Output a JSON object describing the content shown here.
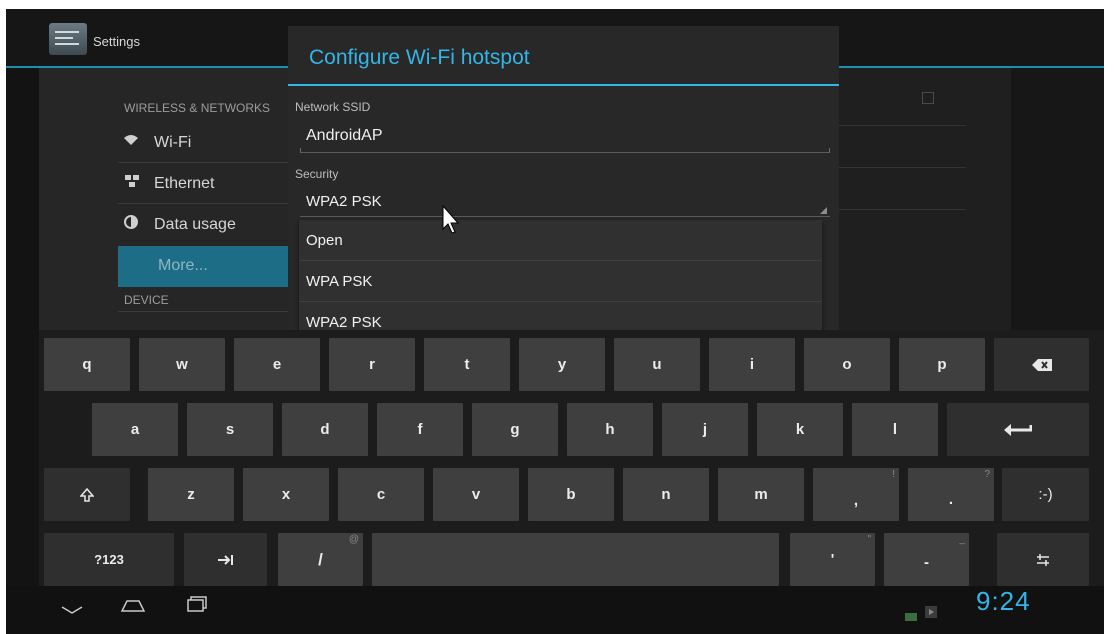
{
  "app": {
    "title": "Settings",
    "icon": "settings-icon"
  },
  "settings_list": {
    "section_wireless": "WIRELESS & NETWORKS",
    "items": [
      {
        "label": "Wi-Fi",
        "icon": "wifi-icon"
      },
      {
        "label": "Ethernet",
        "icon": "ethernet-icon"
      },
      {
        "label": "Data usage",
        "icon": "data-usage-icon"
      },
      {
        "label": "More...",
        "selected": true
      }
    ],
    "section_device": "DEVICE"
  },
  "dialog": {
    "title": "Configure Wi-Fi hotspot",
    "ssid_label": "Network SSID",
    "ssid_value": "AndroidAP",
    "security_label": "Security",
    "security_value": "WPA2 PSK",
    "security_options": [
      "Open",
      "WPA PSK",
      "WPA2 PSK"
    ]
  },
  "keyboard": {
    "row1": [
      "q",
      "w",
      "e",
      "r",
      "t",
      "y",
      "u",
      "i",
      "o",
      "p"
    ],
    "row2": [
      "a",
      "s",
      "d",
      "f",
      "g",
      "h",
      "j",
      "k",
      "l"
    ],
    "row3": [
      "z",
      "x",
      "c",
      "v",
      "b",
      "n",
      "m"
    ],
    "comma": ",",
    "comma_hint": "!",
    "period": ".",
    "period_hint": "?",
    "smiley": ":-)",
    "symbols": "?123",
    "slash": "/",
    "slash_hint": "@",
    "apostrophe": "'",
    "apostrophe_hint": "\"",
    "dash": "-",
    "dash_hint": "_"
  },
  "status": {
    "time": "9:24"
  },
  "colors": {
    "accent": "#33b5e5",
    "selected_row": "#1e6d86"
  }
}
